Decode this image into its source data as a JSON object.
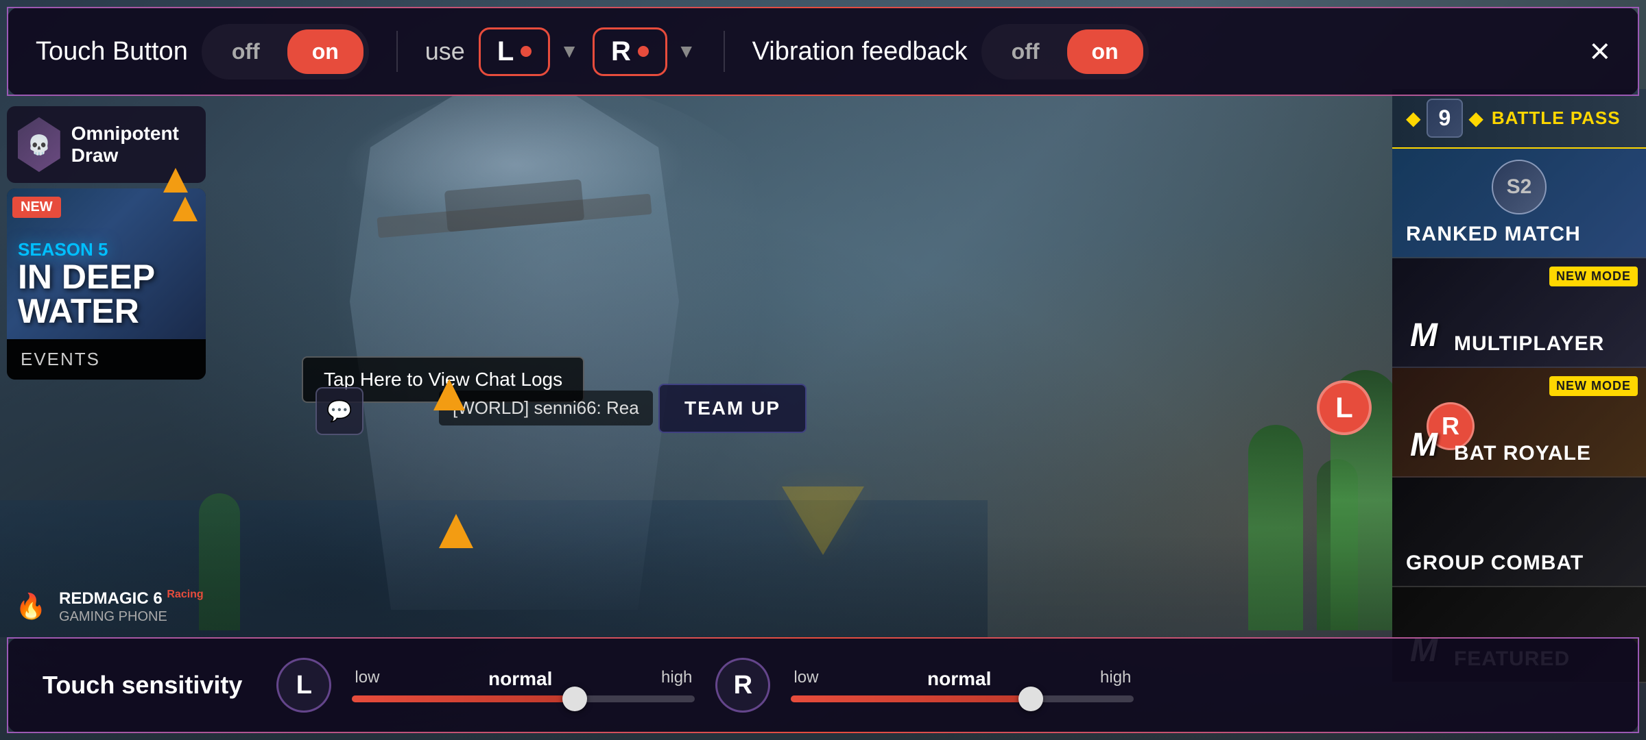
{
  "toolbar": {
    "touch_button_label": "Touch Button",
    "touch_button_off": "off",
    "touch_button_on": "on",
    "touch_button_active": "on",
    "use_label": "use",
    "joystick_left": "L",
    "joystick_right": "R",
    "vibration_label": "Vibration feedback",
    "vibration_off": "off",
    "vibration_on": "on",
    "vibration_active": "on",
    "close_label": "×"
  },
  "bottom_bar": {
    "sensitivity_label": "Touch sensitivity",
    "left_joystick": "L",
    "right_joystick": "R",
    "low": "low",
    "normal_l": "normal",
    "high_l": "high",
    "normal_r": "normal",
    "low_r": "low",
    "high_r": "high"
  },
  "left_panel": {
    "omni_label": "Omnipotent Draw",
    "new_badge": "NEW",
    "season": "SEASON 5",
    "season_title_line1": "IN DEEP",
    "season_title_line2": "WATER",
    "events_label": "EVENTS"
  },
  "right_panel": {
    "battle_pass_num": "9",
    "battle_pass_label": "BATTLE PASS",
    "ranked_label": "RANKED MATCH",
    "ranked_s2": "S2",
    "multiplayer_label": "MULTIPLAYER",
    "multiplayer_new_mode": "NEW MODE",
    "battle_royale_label": "BAT ROYALE",
    "battle_royale_new_mode": "NEW MODE",
    "group_label": "GROUP COMBAT",
    "featured_label": "FEATURED"
  },
  "game_ui": {
    "chat_prompt": "Tap Here to View Chat Logs",
    "world_message": "[WORLD] senni66: Rea",
    "team_up": "TEAM UP"
  },
  "branding": {
    "model": "REDMAGIC 6",
    "model_suffix": "Racing",
    "sub": "GAMING PHONE"
  },
  "indicators": {
    "l_indicator": "L",
    "r_indicator": "R"
  }
}
